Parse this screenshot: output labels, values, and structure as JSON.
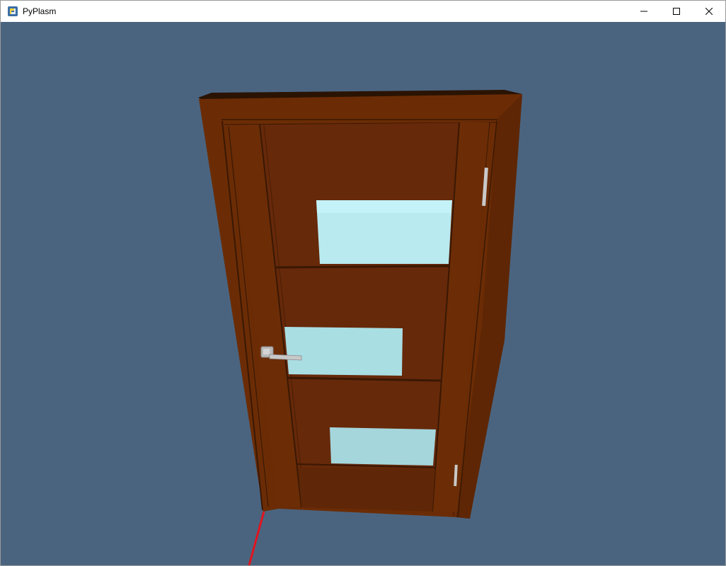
{
  "window": {
    "title": "PyPlasm",
    "app_icon": "python-icon",
    "controls": [
      "minimize-icon",
      "maximize-icon",
      "close-icon"
    ]
  },
  "scene": {
    "background_color": "#4a6480",
    "object": "door",
    "wood_color": "#6b2c05",
    "glass_color": "#b8eaf0",
    "handle_color": "#c8c8c8",
    "axis_color": "#e0141e",
    "glass_panels": 3,
    "hinges": 2
  }
}
